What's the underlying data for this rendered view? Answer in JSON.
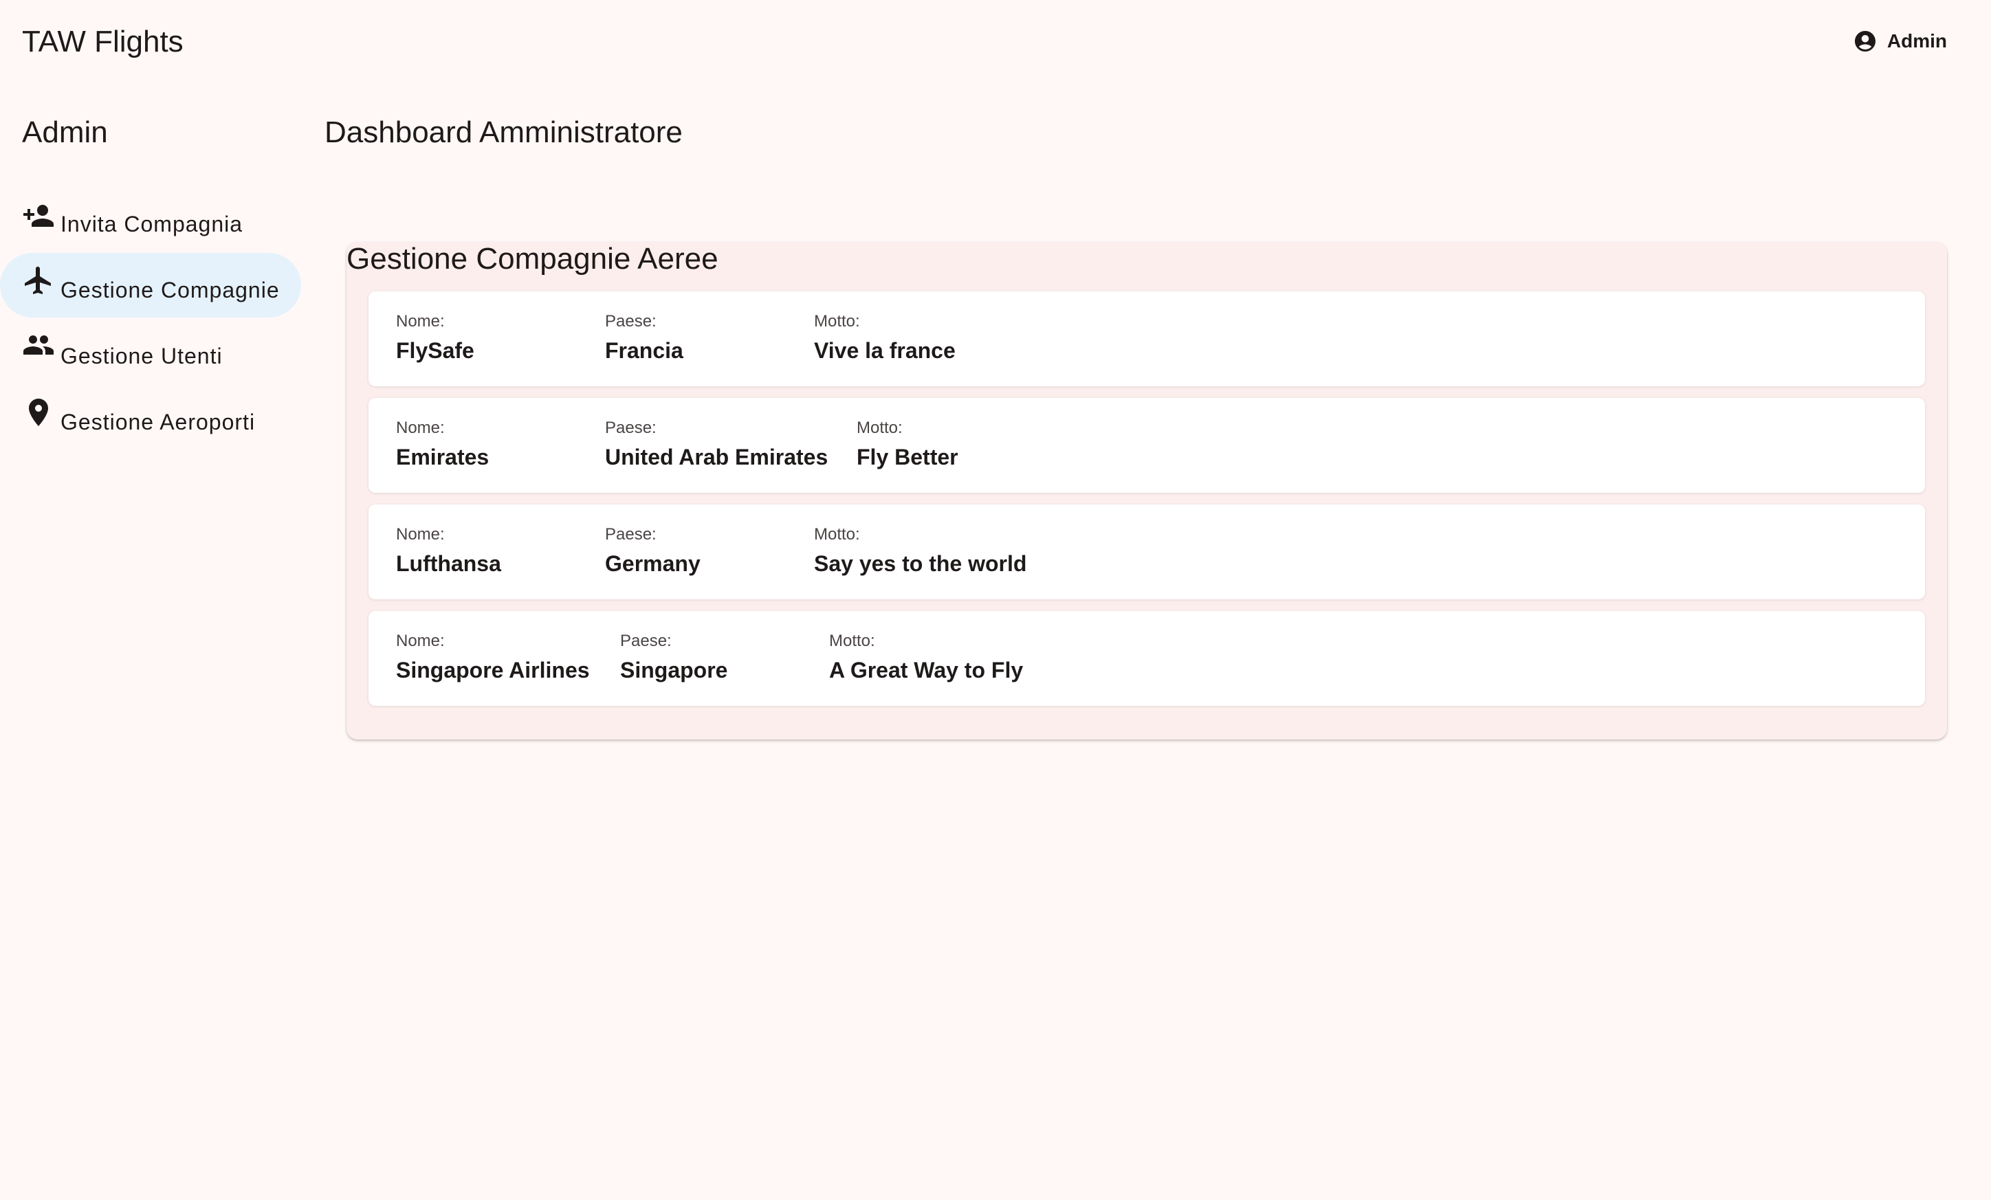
{
  "app": {
    "title": "TAW Flights",
    "user_label": "Admin",
    "user_icon": "account-circle-icon"
  },
  "sidebar": {
    "title": "Admin",
    "items": [
      {
        "label": "Invita Compagnia",
        "icon": "person-add-icon",
        "active": false
      },
      {
        "label": "Gestione Compagnie",
        "icon": "airplane-icon",
        "active": true
      },
      {
        "label": "Gestione Utenti",
        "icon": "group-icon",
        "active": false
      },
      {
        "label": "Gestione Aeroporti",
        "icon": "location-pin-icon",
        "active": false
      }
    ]
  },
  "main": {
    "page_title": "Dashboard Amministratore",
    "panel": {
      "title": "Gestione Compagnie Aeree",
      "field_labels": {
        "name": "Nome:",
        "country": "Paese:",
        "motto": "Motto:"
      },
      "airlines": [
        {
          "name": "FlySafe",
          "country": "Francia",
          "motto": "Vive la france"
        },
        {
          "name": "Emirates",
          "country": "United Arab Emirates",
          "motto": "Fly Better"
        },
        {
          "name": "Lufthansa",
          "country": "Germany",
          "motto": "Say yes to the world"
        },
        {
          "name": "Singapore Airlines",
          "country": "Singapore",
          "motto": "A Great Way to Fly"
        }
      ]
    }
  },
  "colors": {
    "background": "#fff8f7",
    "active_nav": "#e5f2fb",
    "panel": "#fceeed",
    "card": "#ffffff"
  }
}
